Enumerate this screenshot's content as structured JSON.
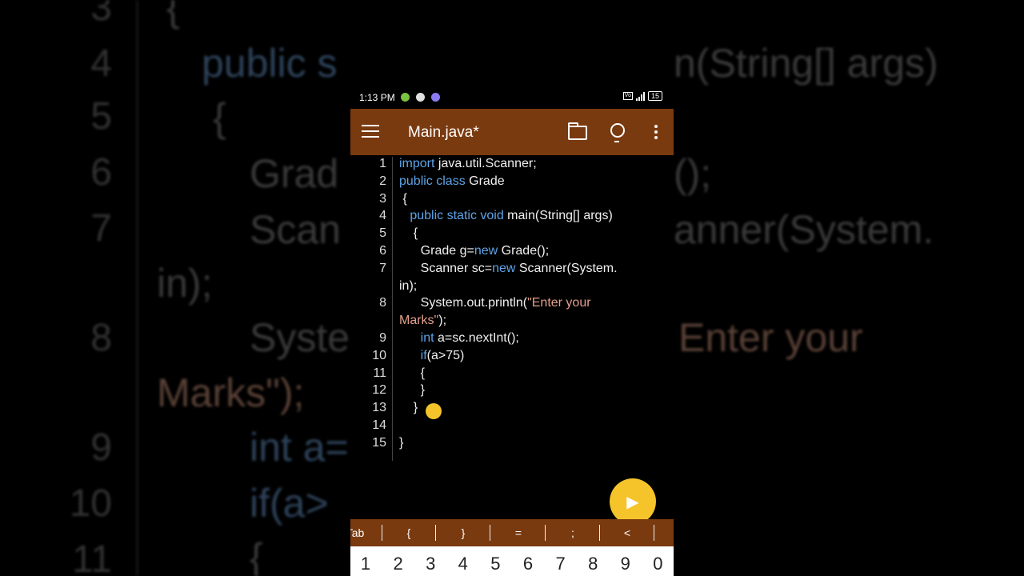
{
  "status_bar": {
    "time": "1:13 PM",
    "battery": "15"
  },
  "app_bar": {
    "title": "Main.java*"
  },
  "code_lines": [
    {
      "n": "1",
      "segs": [
        {
          "t": "import",
          "c": "kw"
        },
        {
          "t": " java.util.Scanner;",
          "c": ""
        }
      ]
    },
    {
      "n": "2",
      "segs": [
        {
          "t": "public class",
          "c": "kw"
        },
        {
          "t": " Grade",
          "c": ""
        }
      ]
    },
    {
      "n": "3",
      "segs": [
        {
          "t": " {",
          "c": ""
        }
      ]
    },
    {
      "n": "4",
      "segs": [
        {
          "t": "   ",
          "c": ""
        },
        {
          "t": "public static void",
          "c": "kw"
        },
        {
          "t": " main(String[] args)",
          "c": ""
        }
      ]
    },
    {
      "n": "5",
      "segs": [
        {
          "t": "    {",
          "c": ""
        }
      ]
    },
    {
      "n": "6",
      "segs": [
        {
          "t": "      Grade g=",
          "c": ""
        },
        {
          "t": "new",
          "c": "kw"
        },
        {
          "t": " Grade();",
          "c": ""
        }
      ]
    },
    {
      "n": "7",
      "segs": [
        {
          "t": "      Scanner sc=",
          "c": ""
        },
        {
          "t": "new",
          "c": "kw"
        },
        {
          "t": " Scanner(System.",
          "c": ""
        }
      ]
    },
    {
      "n": "",
      "segs": [
        {
          "t": "in);",
          "c": ""
        }
      ]
    },
    {
      "n": "8",
      "segs": [
        {
          "t": "      System.out.println(",
          "c": ""
        },
        {
          "t": "\"Enter your",
          "c": "st"
        }
      ]
    },
    {
      "n": "",
      "segs": [
        {
          "t": "Marks\"",
          "c": "st"
        },
        {
          "t": ");",
          "c": ""
        }
      ]
    },
    {
      "n": "9",
      "segs": [
        {
          "t": "      ",
          "c": ""
        },
        {
          "t": "int",
          "c": "kw"
        },
        {
          "t": " a=sc.nextInt();",
          "c": ""
        }
      ]
    },
    {
      "n": "10",
      "segs": [
        {
          "t": "      ",
          "c": ""
        },
        {
          "t": "if",
          "c": "kw"
        },
        {
          "t": "(a>75)",
          "c": ""
        }
      ]
    },
    {
      "n": "11",
      "segs": [
        {
          "t": "      {",
          "c": ""
        }
      ]
    },
    {
      "n": "12",
      "segs": [
        {
          "t": "      }",
          "c": ""
        }
      ]
    },
    {
      "n": "13",
      "segs": [
        {
          "t": "    }",
          "c": ""
        }
      ]
    },
    {
      "n": "14",
      "segs": [
        {
          "t": "",
          "c": ""
        }
      ]
    },
    {
      "n": "15",
      "segs": [
        {
          "t": "}",
          "c": ""
        }
      ]
    }
  ],
  "symbols": [
    "Tab",
    "{",
    "}",
    "=",
    ";",
    "<"
  ],
  "numbers": [
    "1",
    "2",
    "3",
    "4",
    "5",
    "6",
    "7",
    "8",
    "9",
    "0"
  ],
  "background": {
    "line_numbers": [
      "3",
      "4",
      "5",
      "6",
      "7",
      "8",
      "9",
      "10",
      "11"
    ],
    "texts": {
      "l3": "{",
      "l4a": "public s",
      "l4b": "n(String[] args)",
      "l5": "{",
      "l6a": "Grad",
      "l6b": "();",
      "l7a": "Scan",
      "l7b": "anner(System.",
      "l7c": "in);",
      "l8a": "Syste",
      "l8b": "Enter your",
      "l8c": "Marks\");",
      "l9": "int a=",
      "l10": "if(a>",
      "l11": "{"
    }
  },
  "icons": [
    "menu-icon",
    "folder-icon",
    "lightbulb-icon",
    "more-vert-icon",
    "play-icon"
  ],
  "colors": {
    "accent": "#7a3a10",
    "fab": "#f5c42a",
    "keyword": "#5ea3e6",
    "string": "#e0a08a"
  }
}
